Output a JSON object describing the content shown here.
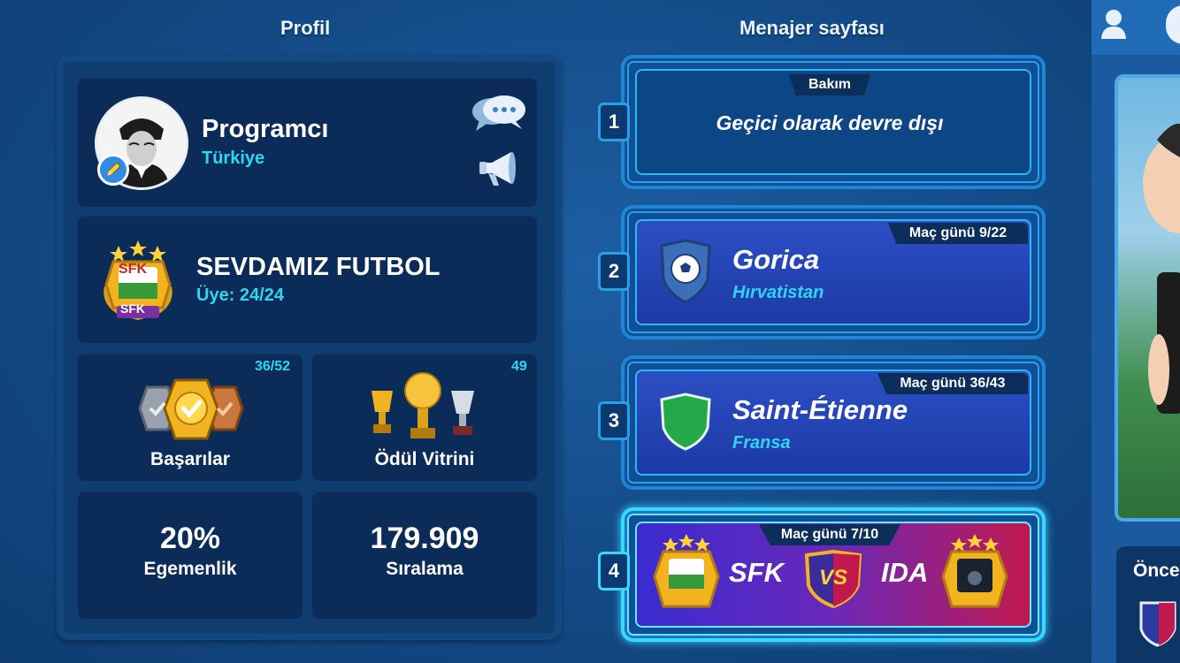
{
  "headers": {
    "profile": "Profil",
    "manager": "Menajer sayfası"
  },
  "profile": {
    "username": "Programcı",
    "country": "Türkiye",
    "club": {
      "name": "SEVDAMIZ FUTBOL",
      "members": "Üye: 24/24",
      "badge_text": "SFK"
    },
    "achievements": {
      "count": "36/52",
      "label": "Başarılar"
    },
    "trophies": {
      "count": "49",
      "label": "Ödül Vitrini"
    },
    "dominance": {
      "value": "20%",
      "label": "Egemenlik"
    },
    "ranking": {
      "value": "179.909",
      "label": "Sıralama"
    }
  },
  "slots": [
    {
      "num": "1",
      "tag": "Bakım",
      "message": "Geçici olarak devre dışı"
    },
    {
      "num": "2",
      "tag": "Maç günü 9/22",
      "team": "Gorica",
      "country": "Hırvatistan"
    },
    {
      "num": "3",
      "tag": "Maç günü 36/43",
      "team": "Saint-Étienne",
      "country": "Fransa"
    },
    {
      "num": "4",
      "tag": "Maç günü 7/10",
      "home": "SFK",
      "vs": "VS",
      "away": "IDA"
    }
  ],
  "right_panel": {
    "label": "Önce"
  },
  "colors": {
    "accent_cyan": "#2fd6f0",
    "gold": "#f2b321",
    "panel": "#0b2c58"
  }
}
